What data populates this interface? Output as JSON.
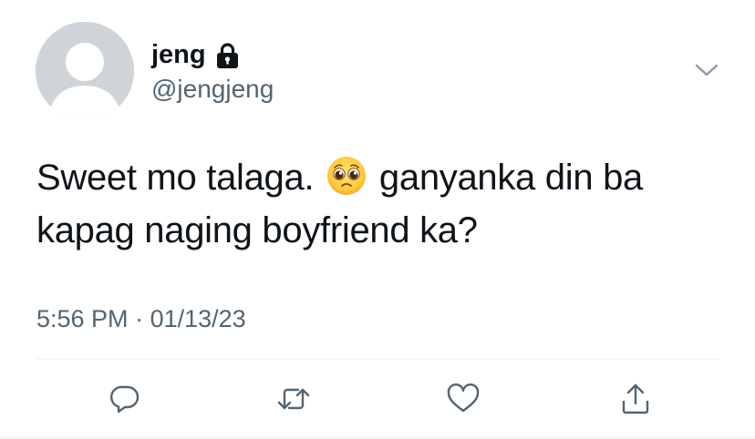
{
  "tweet": {
    "display_name": "jeng",
    "handle": "@jengjeng",
    "protected_icon": "lock-icon",
    "text_line1_before_emoji": "Sweet mo talaga.",
    "emoji": "pleading-face-emoji",
    "text_line1_after_emoji": "ganyanka din ba",
    "text_line2": "kapag naging boyfriend ka?",
    "time": "5:56 PM",
    "separator": "·",
    "date": "01/13/23"
  },
  "actions": {
    "reply": "reply-icon",
    "retweet": "retweet-icon",
    "like": "like-icon",
    "share": "share-icon",
    "more": "chevron-down-icon"
  },
  "colors": {
    "text_primary": "#0f1419",
    "text_secondary": "#536471",
    "avatar_bg": "#cfd4d9",
    "divider": "#eff3f4"
  }
}
